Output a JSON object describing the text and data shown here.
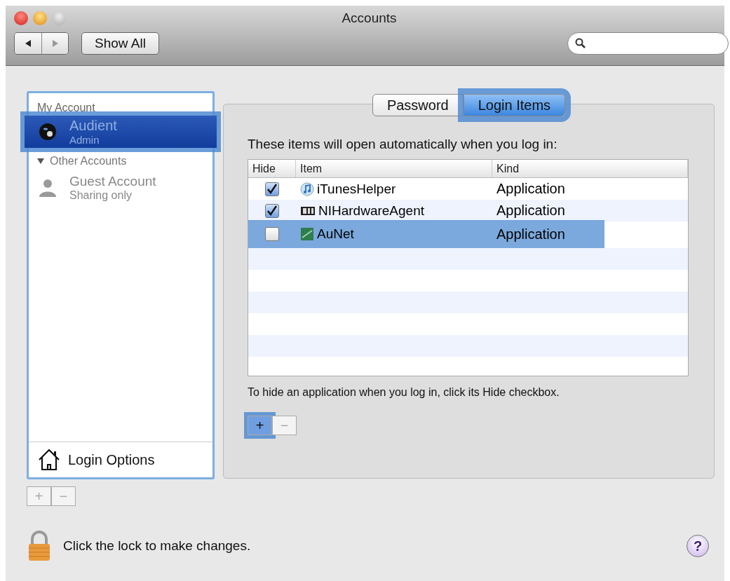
{
  "window": {
    "title": "Accounts"
  },
  "toolbar": {
    "show_all": "Show All"
  },
  "sidebar": {
    "my_account_heading": "My Account",
    "my_account": {
      "name": "Audient",
      "role": "Admin",
      "selected": true,
      "highlighted": true
    },
    "other_heading": {
      "label": "Other Accounts",
      "expanded": true
    },
    "other_accounts": [
      {
        "name": "Guest Account",
        "role": "Sharing only",
        "selected": false,
        "highlighted": false
      }
    ],
    "login_options": "Login Options",
    "add": "+",
    "remove": "−"
  },
  "tabs": [
    {
      "label": "Password",
      "selected": false,
      "highlighted": false
    },
    {
      "label": "Login Items",
      "selected": true,
      "highlighted": true
    }
  ],
  "intro": "These items will open automatically when you log in:",
  "table": {
    "columns": [
      "Hide",
      "Item",
      "Kind"
    ],
    "rows": [
      {
        "hide": true,
        "item": "iTunesHelper",
        "kind": "Application",
        "highlighted": false
      },
      {
        "hide": true,
        "item": "NIHardwareAgent",
        "kind": "Application",
        "highlighted": false
      },
      {
        "hide": false,
        "item": "AuNet",
        "kind": "Application",
        "highlighted": true
      }
    ]
  },
  "hint": "To hide an application when you log in, click its Hide checkbox.",
  "item_buttons": {
    "add": {
      "label": "+",
      "highlighted": true
    },
    "remove": {
      "label": "−",
      "highlighted": false
    }
  },
  "lock_text": "Click the lock to make changes.",
  "help": "?"
}
